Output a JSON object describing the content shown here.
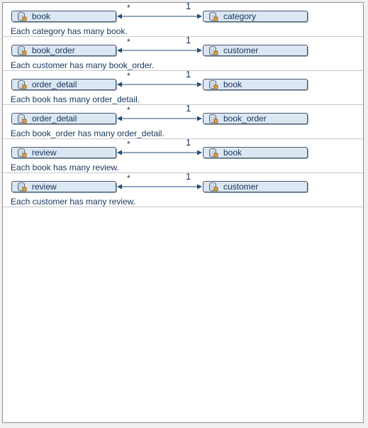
{
  "colors": {
    "line": "#1f4e79",
    "box_fill": "#dbe7f2",
    "text": "#17365d"
  },
  "icons": {
    "table": "database-table-icon"
  },
  "relations": [
    {
      "many": "book",
      "one": "category",
      "many_mult": "*",
      "one_mult": "1",
      "description": "Each category has many book."
    },
    {
      "many": "book_order",
      "one": "customer",
      "many_mult": "*",
      "one_mult": "1",
      "description": "Each customer has many book_order."
    },
    {
      "many": "order_detail",
      "one": "book",
      "many_mult": "*",
      "one_mult": "1",
      "description": "Each book has many order_detail."
    },
    {
      "many": "order_detail",
      "one": "book_order",
      "many_mult": "*",
      "one_mult": "1",
      "description": "Each book_order has many order_detail."
    },
    {
      "many": "review",
      "one": "book",
      "many_mult": "*",
      "one_mult": "1",
      "description": "Each book has many review."
    },
    {
      "many": "review",
      "one": "customer",
      "many_mult": "*",
      "one_mult": "1",
      "description": "Each customer has many review."
    }
  ]
}
